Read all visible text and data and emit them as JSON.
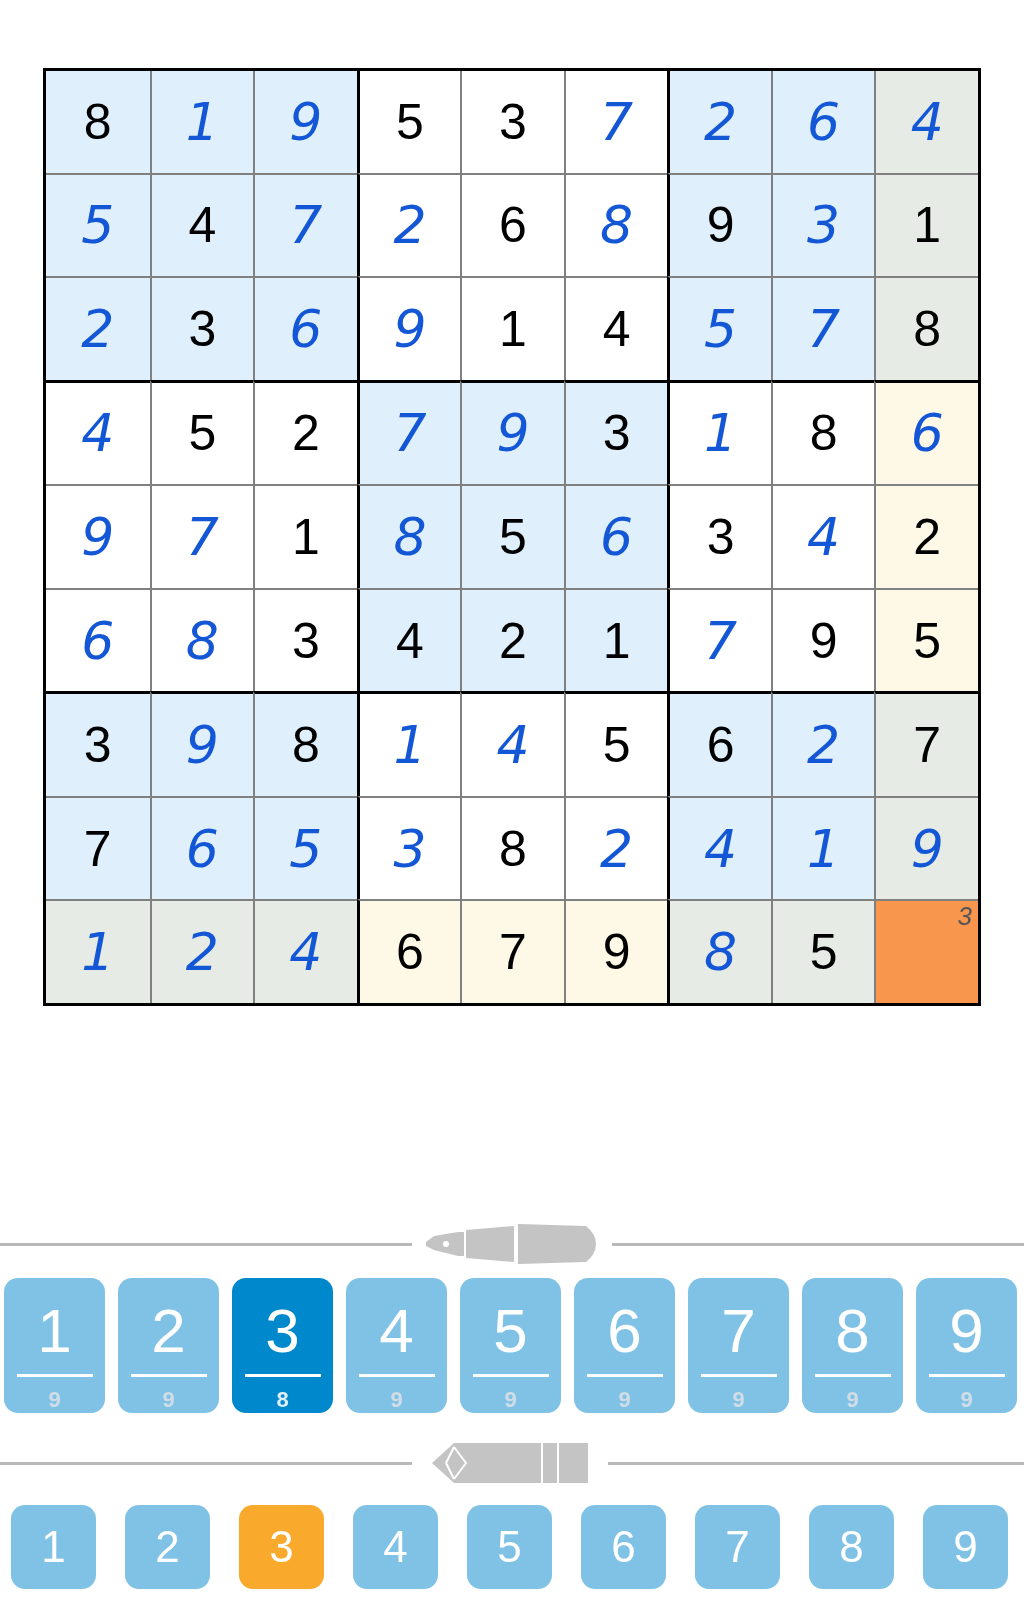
{
  "grid": {
    "rows": [
      [
        {
          "value": "8",
          "kind": "given",
          "color": "#dff0fc"
        },
        {
          "value": "1",
          "kind": "entered",
          "color": "#dff0fc"
        },
        {
          "value": "9",
          "kind": "entered",
          "color": "#dff0fc"
        },
        {
          "value": "5",
          "kind": "given",
          "color": "#ffffff"
        },
        {
          "value": "3",
          "kind": "given",
          "color": "#ffffff"
        },
        {
          "value": "7",
          "kind": "entered",
          "color": "#ffffff"
        },
        {
          "value": "2",
          "kind": "entered",
          "color": "#dff0fc"
        },
        {
          "value": "6",
          "kind": "entered",
          "color": "#dff0fc"
        },
        {
          "value": "4",
          "kind": "entered",
          "color": "#e6ebe5"
        }
      ],
      [
        {
          "value": "5",
          "kind": "entered",
          "color": "#dff0fc"
        },
        {
          "value": "4",
          "kind": "given",
          "color": "#dff0fc"
        },
        {
          "value": "7",
          "kind": "entered",
          "color": "#dff0fc"
        },
        {
          "value": "2",
          "kind": "entered",
          "color": "#ffffff"
        },
        {
          "value": "6",
          "kind": "given",
          "color": "#ffffff"
        },
        {
          "value": "8",
          "kind": "entered",
          "color": "#ffffff"
        },
        {
          "value": "9",
          "kind": "given",
          "color": "#dff0fc"
        },
        {
          "value": "3",
          "kind": "entered",
          "color": "#dff0fc"
        },
        {
          "value": "1",
          "kind": "given",
          "color": "#e6ebe5"
        }
      ],
      [
        {
          "value": "2",
          "kind": "entered",
          "color": "#dff0fc"
        },
        {
          "value": "3",
          "kind": "given",
          "color": "#dff0fc"
        },
        {
          "value": "6",
          "kind": "entered",
          "color": "#dff0fc"
        },
        {
          "value": "9",
          "kind": "entered",
          "color": "#ffffff"
        },
        {
          "value": "1",
          "kind": "given",
          "color": "#ffffff"
        },
        {
          "value": "4",
          "kind": "given",
          "color": "#ffffff"
        },
        {
          "value": "5",
          "kind": "entered",
          "color": "#dff0fc"
        },
        {
          "value": "7",
          "kind": "entered",
          "color": "#dff0fc"
        },
        {
          "value": "8",
          "kind": "given",
          "color": "#e6ebe5"
        }
      ],
      [
        {
          "value": "4",
          "kind": "entered",
          "color": "#ffffff"
        },
        {
          "value": "5",
          "kind": "given",
          "color": "#ffffff"
        },
        {
          "value": "2",
          "kind": "given",
          "color": "#ffffff"
        },
        {
          "value": "7",
          "kind": "entered",
          "color": "#dff0fc"
        },
        {
          "value": "9",
          "kind": "entered",
          "color": "#dff0fc"
        },
        {
          "value": "3",
          "kind": "given",
          "color": "#dff0fc"
        },
        {
          "value": "1",
          "kind": "entered",
          "color": "#ffffff"
        },
        {
          "value": "8",
          "kind": "given",
          "color": "#ffffff"
        },
        {
          "value": "6",
          "kind": "entered",
          "color": "#fef8e6"
        }
      ],
      [
        {
          "value": "9",
          "kind": "entered",
          "color": "#ffffff"
        },
        {
          "value": "7",
          "kind": "entered",
          "color": "#ffffff"
        },
        {
          "value": "1",
          "kind": "given",
          "color": "#ffffff"
        },
        {
          "value": "8",
          "kind": "entered",
          "color": "#dff0fc"
        },
        {
          "value": "5",
          "kind": "given",
          "color": "#dff0fc"
        },
        {
          "value": "6",
          "kind": "entered",
          "color": "#dff0fc"
        },
        {
          "value": "3",
          "kind": "given",
          "color": "#ffffff"
        },
        {
          "value": "4",
          "kind": "entered",
          "color": "#ffffff"
        },
        {
          "value": "2",
          "kind": "given",
          "color": "#fef8e6"
        }
      ],
      [
        {
          "value": "6",
          "kind": "entered",
          "color": "#ffffff"
        },
        {
          "value": "8",
          "kind": "entered",
          "color": "#ffffff"
        },
        {
          "value": "3",
          "kind": "given",
          "color": "#ffffff"
        },
        {
          "value": "4",
          "kind": "given",
          "color": "#dff0fc"
        },
        {
          "value": "2",
          "kind": "given",
          "color": "#dff0fc"
        },
        {
          "value": "1",
          "kind": "given",
          "color": "#dff0fc"
        },
        {
          "value": "7",
          "kind": "entered",
          "color": "#ffffff"
        },
        {
          "value": "9",
          "kind": "given",
          "color": "#ffffff"
        },
        {
          "value": "5",
          "kind": "given",
          "color": "#fef8e6"
        }
      ],
      [
        {
          "value": "3",
          "kind": "given",
          "color": "#dff0fc"
        },
        {
          "value": "9",
          "kind": "entered",
          "color": "#dff0fc"
        },
        {
          "value": "8",
          "kind": "given",
          "color": "#dff0fc"
        },
        {
          "value": "1",
          "kind": "entered",
          "color": "#ffffff"
        },
        {
          "value": "4",
          "kind": "entered",
          "color": "#ffffff"
        },
        {
          "value": "5",
          "kind": "given",
          "color": "#ffffff"
        },
        {
          "value": "6",
          "kind": "given",
          "color": "#dff0fc"
        },
        {
          "value": "2",
          "kind": "entered",
          "color": "#dff0fc"
        },
        {
          "value": "7",
          "kind": "given",
          "color": "#e6ebe5"
        }
      ],
      [
        {
          "value": "7",
          "kind": "given",
          "color": "#dff0fc"
        },
        {
          "value": "6",
          "kind": "entered",
          "color": "#dff0fc"
        },
        {
          "value": "5",
          "kind": "entered",
          "color": "#dff0fc"
        },
        {
          "value": "3",
          "kind": "entered",
          "color": "#ffffff"
        },
        {
          "value": "8",
          "kind": "given",
          "color": "#ffffff"
        },
        {
          "value": "2",
          "kind": "entered",
          "color": "#ffffff"
        },
        {
          "value": "4",
          "kind": "entered",
          "color": "#dff0fc"
        },
        {
          "value": "1",
          "kind": "entered",
          "color": "#dff0fc"
        },
        {
          "value": "9",
          "kind": "entered",
          "color": "#e6ebe5"
        }
      ],
      [
        {
          "value": "1",
          "kind": "entered",
          "color": "#e6ebe5"
        },
        {
          "value": "2",
          "kind": "entered",
          "color": "#e6ebe5"
        },
        {
          "value": "4",
          "kind": "entered",
          "color": "#e6ebe5"
        },
        {
          "value": "6",
          "kind": "given",
          "color": "#fef8e6"
        },
        {
          "value": "7",
          "kind": "given",
          "color": "#fef8e6"
        },
        {
          "value": "9",
          "kind": "given",
          "color": "#fef8e6"
        },
        {
          "value": "8",
          "kind": "entered",
          "color": "#e6ebe5"
        },
        {
          "value": "5",
          "kind": "given",
          "color": "#e6ebe5"
        },
        {
          "kind": "notes",
          "notes": "3",
          "color": "#f8964d"
        }
      ]
    ]
  },
  "number_pad": [
    {
      "digit": "1",
      "remaining": "9",
      "selected": false
    },
    {
      "digit": "2",
      "remaining": "9",
      "selected": false
    },
    {
      "digit": "3",
      "remaining": "8",
      "selected": true
    },
    {
      "digit": "4",
      "remaining": "9",
      "selected": false
    },
    {
      "digit": "5",
      "remaining": "9",
      "selected": false
    },
    {
      "digit": "6",
      "remaining": "9",
      "selected": false
    },
    {
      "digit": "7",
      "remaining": "9",
      "selected": false
    },
    {
      "digit": "8",
      "remaining": "9",
      "selected": false
    },
    {
      "digit": "9",
      "remaining": "9",
      "selected": false
    }
  ],
  "notes_pad": [
    {
      "digit": "1",
      "selected": false
    },
    {
      "digit": "2",
      "selected": false
    },
    {
      "digit": "3",
      "selected": true
    },
    {
      "digit": "4",
      "selected": false
    },
    {
      "digit": "5",
      "selected": false
    },
    {
      "digit": "6",
      "selected": false
    },
    {
      "digit": "7",
      "selected": false
    },
    {
      "digit": "8",
      "selected": false
    },
    {
      "digit": "9",
      "selected": false
    }
  ]
}
